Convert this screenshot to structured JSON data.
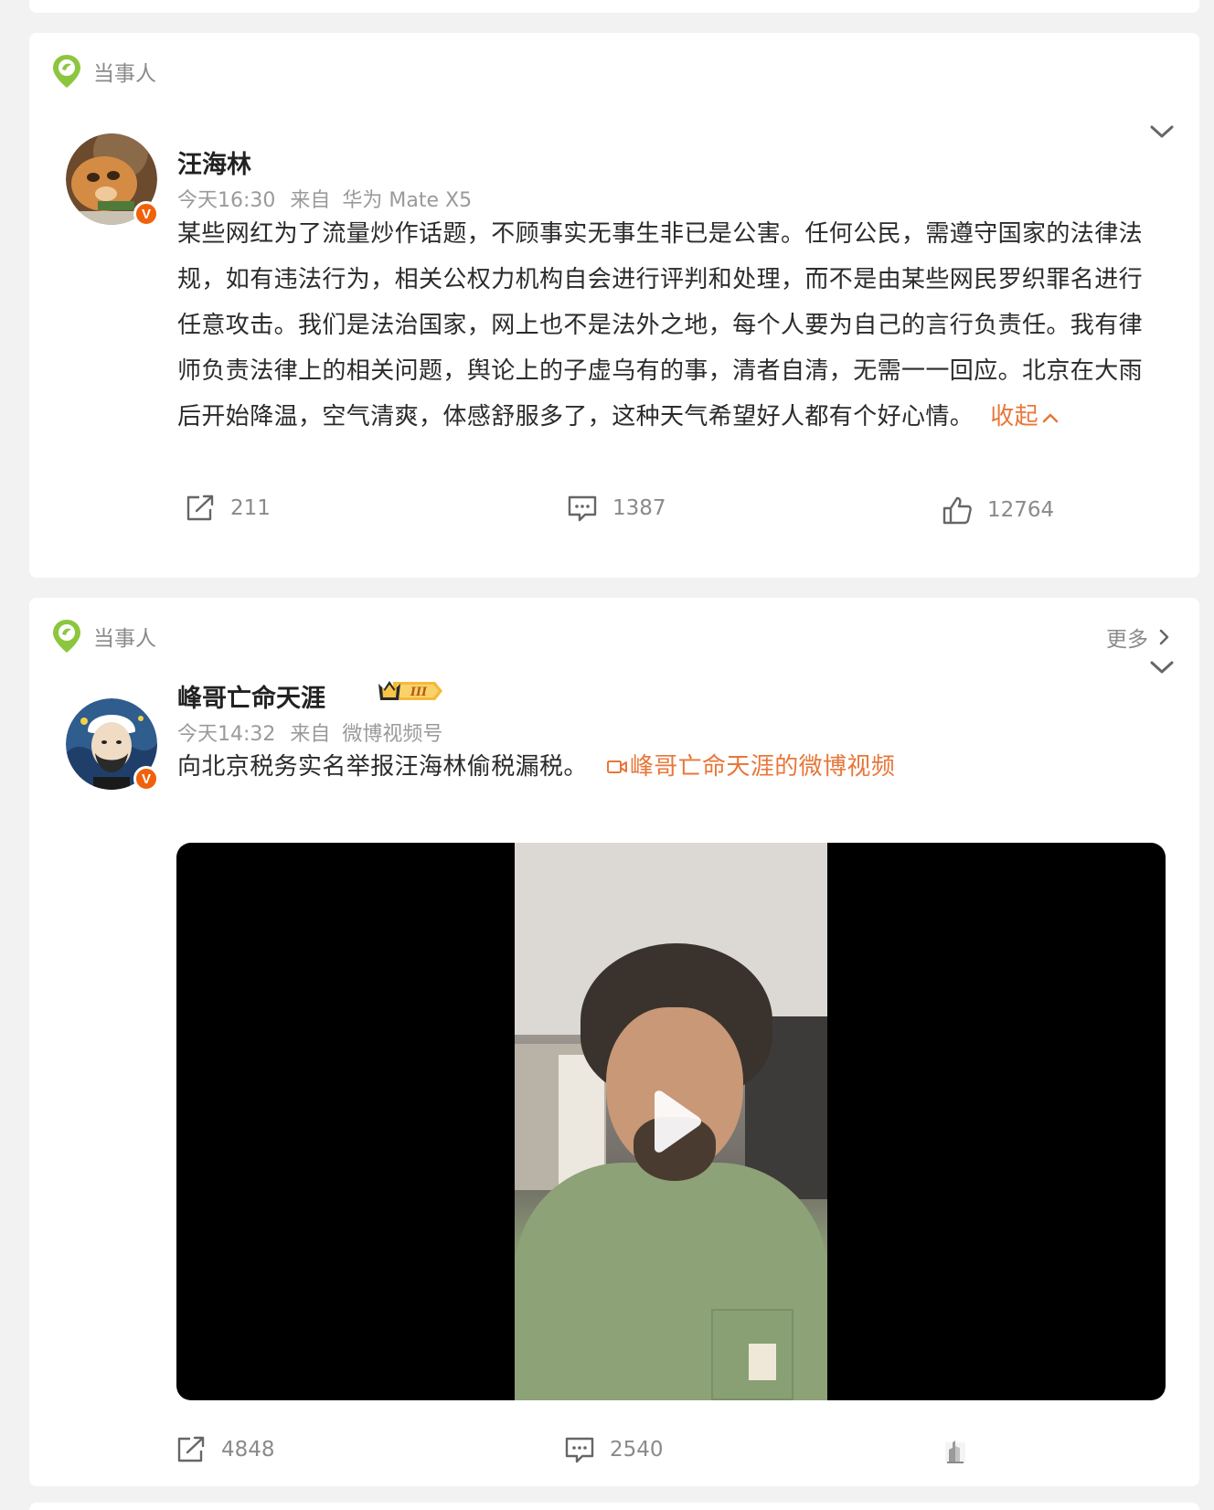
{
  "posts": [
    {
      "tag_label": "当事人",
      "user_name": "汪海林",
      "time": "今天16:30",
      "source_prefix": "来自",
      "source": "华为 Mate X5",
      "text": "某些网红为了流量炒作话题，不顾事实无事生非已是公害。任何公民，需遵守国家的法律法规，如有违法行为，相关公权力机构自会进行评判和处理，而不是由某些网民罗织罪名进行任意攻击。我们是法治国家，网上也不是法外之地，每个人要为自己的言行负责任。我有律师负责法律上的相关问题，舆论上的子虚乌有的事，清者自清，无需一一回应。北京在大雨后开始降温，空气清爽，体感舒服多了，这种天气希望好人都有个好心情。",
      "collapse_label": "收起",
      "reposts": "211",
      "comments": "1387",
      "likes": "12764"
    },
    {
      "tag_label": "当事人",
      "more_label": "更多",
      "user_name": "峰哥亡命天涯",
      "rank_badge": "III",
      "time": "今天14:32",
      "source_prefix": "来自",
      "source": "微博视频号",
      "text": "向北京税务实名举报汪海林偷税漏税。",
      "video_link_label": "峰哥亡命天涯的微博视频",
      "reposts": "4848",
      "comments": "2540"
    }
  ],
  "colors": {
    "accent": "#e8773a",
    "verified": "#f0610b",
    "tag_green": "#7cc24a",
    "muted": "#8a8a8a",
    "background": "#f2f2f2"
  },
  "icons": {
    "tag": "location-pin-icon",
    "collapse": "chevron-down-icon",
    "repost": "share-icon",
    "comment": "comment-icon",
    "like": "thumb-up-icon",
    "video": "video-camera-icon",
    "play": "play-icon"
  }
}
